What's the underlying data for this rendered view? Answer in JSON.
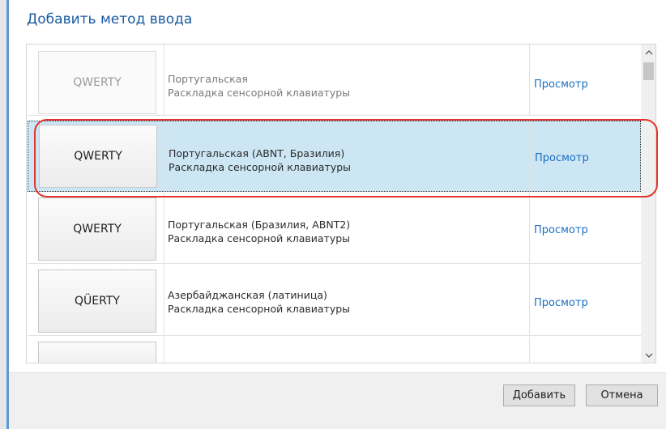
{
  "dialog": {
    "title": "Добавить метод ввода"
  },
  "list": {
    "items": [
      {
        "keyboard_label": "QWERTY",
        "name": "Португальская",
        "type": "Раскладка сенсорной клавиатуры",
        "preview_label": "Просмотр",
        "state": "faded"
      },
      {
        "keyboard_label": "QWERTY",
        "name": "Португальская (ABNT, Бразилия)",
        "type": "Раскладка сенсорной клавиатуры",
        "preview_label": "Просмотр",
        "state": "selected"
      },
      {
        "keyboard_label": "QWERTY",
        "name": "Португальская (Бразилия, ABNT2)",
        "type": "Раскладка сенсорной клавиатуры",
        "preview_label": "Просмотр",
        "state": "normal"
      },
      {
        "keyboard_label": "QÜERTY",
        "name": "Азербайджанская (латиница)",
        "type": "Раскладка сенсорной клавиатуры",
        "preview_label": "Просмотр",
        "state": "normal"
      }
    ]
  },
  "footer": {
    "add_label": "Добавить",
    "cancel_label": "Отмена"
  },
  "colors": {
    "accent": "#5b9bd5",
    "title": "#1a5aa0",
    "link": "#1a6fbf",
    "selection": "#cce6f4",
    "annotation": "#e3342f"
  },
  "icons": {
    "scroll_up": "chevron-up-icon",
    "scroll_down": "chevron-down-icon"
  }
}
